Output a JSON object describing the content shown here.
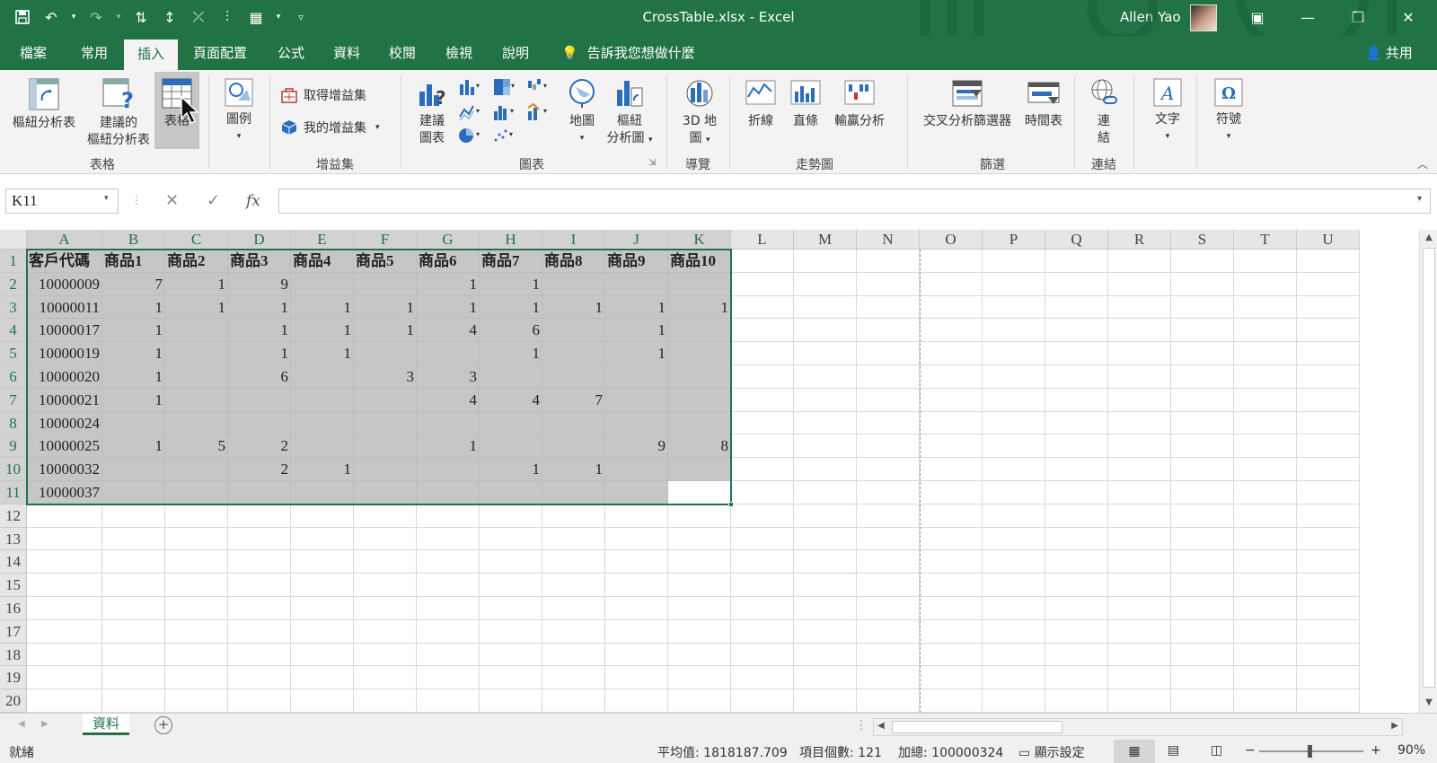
{
  "window": {
    "title": "CrossTable.xlsx  -  Excel",
    "user": "Allen Yao"
  },
  "tabs": [
    "檔案",
    "常用",
    "插入",
    "頁面配置",
    "公式",
    "資料",
    "校閱",
    "檢視",
    "說明"
  ],
  "tell_me": "告訴我您想做什麼",
  "share": "共用",
  "ribbon": {
    "pivot_table": "樞紐分析表",
    "recommended_pivot_1": "建議的",
    "recommended_pivot_2": "樞紐分析表",
    "table": "表格",
    "group_tables": "表格",
    "illustrations": "圖例",
    "get_addins": "取得增益集",
    "my_addins": "我的增益集",
    "group_addins": "增益集",
    "recommended_charts_1": "建議",
    "recommended_charts_2": "圖表",
    "maps": "地圖",
    "pivot_chart_1": "樞紐",
    "pivot_chart_2": "分析圖",
    "group_charts": "圖表",
    "map3d_1": "3D 地",
    "map3d_2": "圖",
    "group_tours": "導覽",
    "line": "折線",
    "column": "直條",
    "winloss": "輸贏分析",
    "group_sparklines": "走勢圖",
    "slicer": "交叉分析篩選器",
    "timeline": "時間表",
    "group_filters": "篩選",
    "link_1": "連",
    "link_2": "結",
    "group_links": "連結",
    "text": "文字",
    "symbols": "符號"
  },
  "formula_bar": {
    "name_box": "K11",
    "cancel": "✕",
    "enter": "✓",
    "fx": "fx",
    "value": ""
  },
  "columns": [
    "A",
    "B",
    "C",
    "D",
    "E",
    "F",
    "G",
    "H",
    "I",
    "J",
    "K",
    "L",
    "M",
    "N",
    "O",
    "P",
    "Q",
    "R",
    "S",
    "T",
    "U"
  ],
  "rows": [
    [
      "客戶代碼",
      "商品1",
      "商品2",
      "商品3",
      "商品4",
      "商品5",
      "商品6",
      "商品7",
      "商品8",
      "商品9",
      "商品10"
    ],
    [
      "10000009",
      "7",
      "1",
      "9",
      "",
      "",
      "1",
      "1",
      "",
      "",
      ""
    ],
    [
      "10000011",
      "1",
      "1",
      "1",
      "1",
      "1",
      "1",
      "1",
      "1",
      "1",
      "1"
    ],
    [
      "10000017",
      "1",
      "",
      "1",
      "1",
      "1",
      "4",
      "6",
      "",
      "1",
      ""
    ],
    [
      "10000019",
      "1",
      "",
      "1",
      "1",
      "",
      "",
      "1",
      "",
      "1",
      ""
    ],
    [
      "10000020",
      "1",
      "",
      "6",
      "",
      "3",
      "3",
      "",
      "",
      "",
      ""
    ],
    [
      "10000021",
      "1",
      "",
      "",
      "",
      "",
      "4",
      "4",
      "7",
      "",
      ""
    ],
    [
      "10000024",
      "",
      "",
      "",
      "",
      "",
      "",
      "",
      "",
      "",
      ""
    ],
    [
      "10000025",
      "1",
      "5",
      "2",
      "",
      "",
      "1",
      "",
      "",
      "9",
      "8"
    ],
    [
      "10000032",
      "",
      "",
      "2",
      "1",
      "",
      "",
      "1",
      "1",
      "",
      ""
    ],
    [
      "10000037",
      "",
      "",
      "",
      "",
      "",
      "",
      "",
      "",
      "",
      ""
    ],
    [
      "",
      "",
      "",
      "",
      "",
      "",
      "",
      "",
      "",
      "",
      ""
    ],
    [
      "",
      "",
      "",
      "",
      "",
      "",
      "",
      "",
      "",
      "",
      ""
    ],
    [
      "",
      "",
      "",
      "",
      "",
      "",
      "",
      "",
      "",
      "",
      ""
    ],
    [
      "",
      "",
      "",
      "",
      "",
      "",
      "",
      "",
      "",
      "",
      ""
    ],
    [
      "",
      "",
      "",
      "",
      "",
      "",
      "",
      "",
      "",
      "",
      ""
    ],
    [
      "",
      "",
      "",
      "",
      "",
      "",
      "",
      "",
      "",
      "",
      ""
    ],
    [
      "",
      "",
      "",
      "",
      "",
      "",
      "",
      "",
      "",
      "",
      ""
    ],
    [
      "",
      "",
      "",
      "",
      "",
      "",
      "",
      "",
      "",
      "",
      ""
    ],
    [
      "",
      "",
      "",
      "",
      "",
      "",
      "",
      "",
      "",
      "",
      ""
    ]
  ],
  "sheets": [
    "資料"
  ],
  "status": {
    "ready": "就緒",
    "average": "平均值: 1818187.709",
    "count": "項目個數: 121",
    "sum": "加總: 100000324",
    "display_settings": "顯示設定",
    "zoom": "90%"
  },
  "colors": {
    "excel_green": "#217346",
    "selection_fill": "#c6c6c6"
  }
}
